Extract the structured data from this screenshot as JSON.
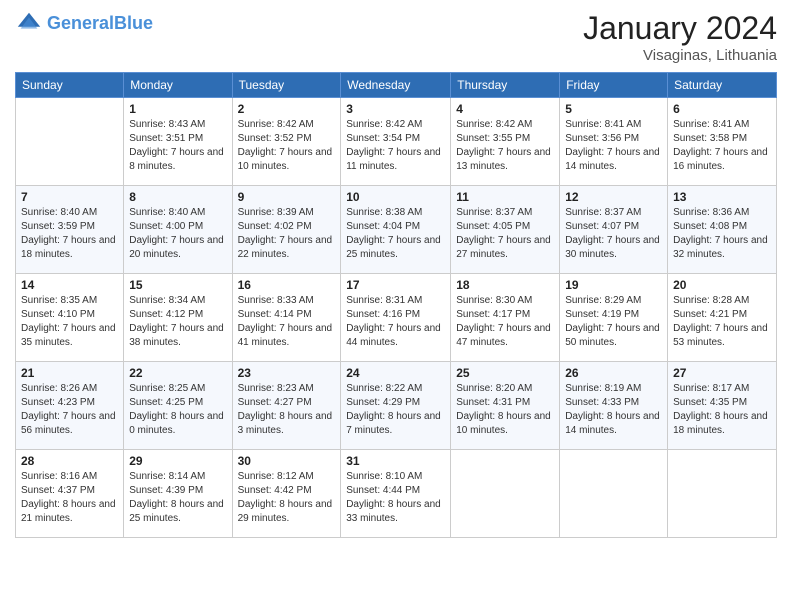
{
  "header": {
    "logo_line1": "General",
    "logo_line2": "Blue",
    "month": "January 2024",
    "location": "Visaginas, Lithuania"
  },
  "weekdays": [
    "Sunday",
    "Monday",
    "Tuesday",
    "Wednesday",
    "Thursday",
    "Friday",
    "Saturday"
  ],
  "weeks": [
    [
      {
        "day": "",
        "sunrise": "",
        "sunset": "",
        "daylight": ""
      },
      {
        "day": "1",
        "sunrise": "Sunrise: 8:43 AM",
        "sunset": "Sunset: 3:51 PM",
        "daylight": "Daylight: 7 hours and 8 minutes."
      },
      {
        "day": "2",
        "sunrise": "Sunrise: 8:42 AM",
        "sunset": "Sunset: 3:52 PM",
        "daylight": "Daylight: 7 hours and 10 minutes."
      },
      {
        "day": "3",
        "sunrise": "Sunrise: 8:42 AM",
        "sunset": "Sunset: 3:54 PM",
        "daylight": "Daylight: 7 hours and 11 minutes."
      },
      {
        "day": "4",
        "sunrise": "Sunrise: 8:42 AM",
        "sunset": "Sunset: 3:55 PM",
        "daylight": "Daylight: 7 hours and 13 minutes."
      },
      {
        "day": "5",
        "sunrise": "Sunrise: 8:41 AM",
        "sunset": "Sunset: 3:56 PM",
        "daylight": "Daylight: 7 hours and 14 minutes."
      },
      {
        "day": "6",
        "sunrise": "Sunrise: 8:41 AM",
        "sunset": "Sunset: 3:58 PM",
        "daylight": "Daylight: 7 hours and 16 minutes."
      }
    ],
    [
      {
        "day": "7",
        "sunrise": "Sunrise: 8:40 AM",
        "sunset": "Sunset: 3:59 PM",
        "daylight": "Daylight: 7 hours and 18 minutes."
      },
      {
        "day": "8",
        "sunrise": "Sunrise: 8:40 AM",
        "sunset": "Sunset: 4:00 PM",
        "daylight": "Daylight: 7 hours and 20 minutes."
      },
      {
        "day": "9",
        "sunrise": "Sunrise: 8:39 AM",
        "sunset": "Sunset: 4:02 PM",
        "daylight": "Daylight: 7 hours and 22 minutes."
      },
      {
        "day": "10",
        "sunrise": "Sunrise: 8:38 AM",
        "sunset": "Sunset: 4:04 PM",
        "daylight": "Daylight: 7 hours and 25 minutes."
      },
      {
        "day": "11",
        "sunrise": "Sunrise: 8:37 AM",
        "sunset": "Sunset: 4:05 PM",
        "daylight": "Daylight: 7 hours and 27 minutes."
      },
      {
        "day": "12",
        "sunrise": "Sunrise: 8:37 AM",
        "sunset": "Sunset: 4:07 PM",
        "daylight": "Daylight: 7 hours and 30 minutes."
      },
      {
        "day": "13",
        "sunrise": "Sunrise: 8:36 AM",
        "sunset": "Sunset: 4:08 PM",
        "daylight": "Daylight: 7 hours and 32 minutes."
      }
    ],
    [
      {
        "day": "14",
        "sunrise": "Sunrise: 8:35 AM",
        "sunset": "Sunset: 4:10 PM",
        "daylight": "Daylight: 7 hours and 35 minutes."
      },
      {
        "day": "15",
        "sunrise": "Sunrise: 8:34 AM",
        "sunset": "Sunset: 4:12 PM",
        "daylight": "Daylight: 7 hours and 38 minutes."
      },
      {
        "day": "16",
        "sunrise": "Sunrise: 8:33 AM",
        "sunset": "Sunset: 4:14 PM",
        "daylight": "Daylight: 7 hours and 41 minutes."
      },
      {
        "day": "17",
        "sunrise": "Sunrise: 8:31 AM",
        "sunset": "Sunset: 4:16 PM",
        "daylight": "Daylight: 7 hours and 44 minutes."
      },
      {
        "day": "18",
        "sunrise": "Sunrise: 8:30 AM",
        "sunset": "Sunset: 4:17 PM",
        "daylight": "Daylight: 7 hours and 47 minutes."
      },
      {
        "day": "19",
        "sunrise": "Sunrise: 8:29 AM",
        "sunset": "Sunset: 4:19 PM",
        "daylight": "Daylight: 7 hours and 50 minutes."
      },
      {
        "day": "20",
        "sunrise": "Sunrise: 8:28 AM",
        "sunset": "Sunset: 4:21 PM",
        "daylight": "Daylight: 7 hours and 53 minutes."
      }
    ],
    [
      {
        "day": "21",
        "sunrise": "Sunrise: 8:26 AM",
        "sunset": "Sunset: 4:23 PM",
        "daylight": "Daylight: 7 hours and 56 minutes."
      },
      {
        "day": "22",
        "sunrise": "Sunrise: 8:25 AM",
        "sunset": "Sunset: 4:25 PM",
        "daylight": "Daylight: 8 hours and 0 minutes."
      },
      {
        "day": "23",
        "sunrise": "Sunrise: 8:23 AM",
        "sunset": "Sunset: 4:27 PM",
        "daylight": "Daylight: 8 hours and 3 minutes."
      },
      {
        "day": "24",
        "sunrise": "Sunrise: 8:22 AM",
        "sunset": "Sunset: 4:29 PM",
        "daylight": "Daylight: 8 hours and 7 minutes."
      },
      {
        "day": "25",
        "sunrise": "Sunrise: 8:20 AM",
        "sunset": "Sunset: 4:31 PM",
        "daylight": "Daylight: 8 hours and 10 minutes."
      },
      {
        "day": "26",
        "sunrise": "Sunrise: 8:19 AM",
        "sunset": "Sunset: 4:33 PM",
        "daylight": "Daylight: 8 hours and 14 minutes."
      },
      {
        "day": "27",
        "sunrise": "Sunrise: 8:17 AM",
        "sunset": "Sunset: 4:35 PM",
        "daylight": "Daylight: 8 hours and 18 minutes."
      }
    ],
    [
      {
        "day": "28",
        "sunrise": "Sunrise: 8:16 AM",
        "sunset": "Sunset: 4:37 PM",
        "daylight": "Daylight: 8 hours and 21 minutes."
      },
      {
        "day": "29",
        "sunrise": "Sunrise: 8:14 AM",
        "sunset": "Sunset: 4:39 PM",
        "daylight": "Daylight: 8 hours and 25 minutes."
      },
      {
        "day": "30",
        "sunrise": "Sunrise: 8:12 AM",
        "sunset": "Sunset: 4:42 PM",
        "daylight": "Daylight: 8 hours and 29 minutes."
      },
      {
        "day": "31",
        "sunrise": "Sunrise: 8:10 AM",
        "sunset": "Sunset: 4:44 PM",
        "daylight": "Daylight: 8 hours and 33 minutes."
      },
      {
        "day": "",
        "sunrise": "",
        "sunset": "",
        "daylight": ""
      },
      {
        "day": "",
        "sunrise": "",
        "sunset": "",
        "daylight": ""
      },
      {
        "day": "",
        "sunrise": "",
        "sunset": "",
        "daylight": ""
      }
    ]
  ]
}
